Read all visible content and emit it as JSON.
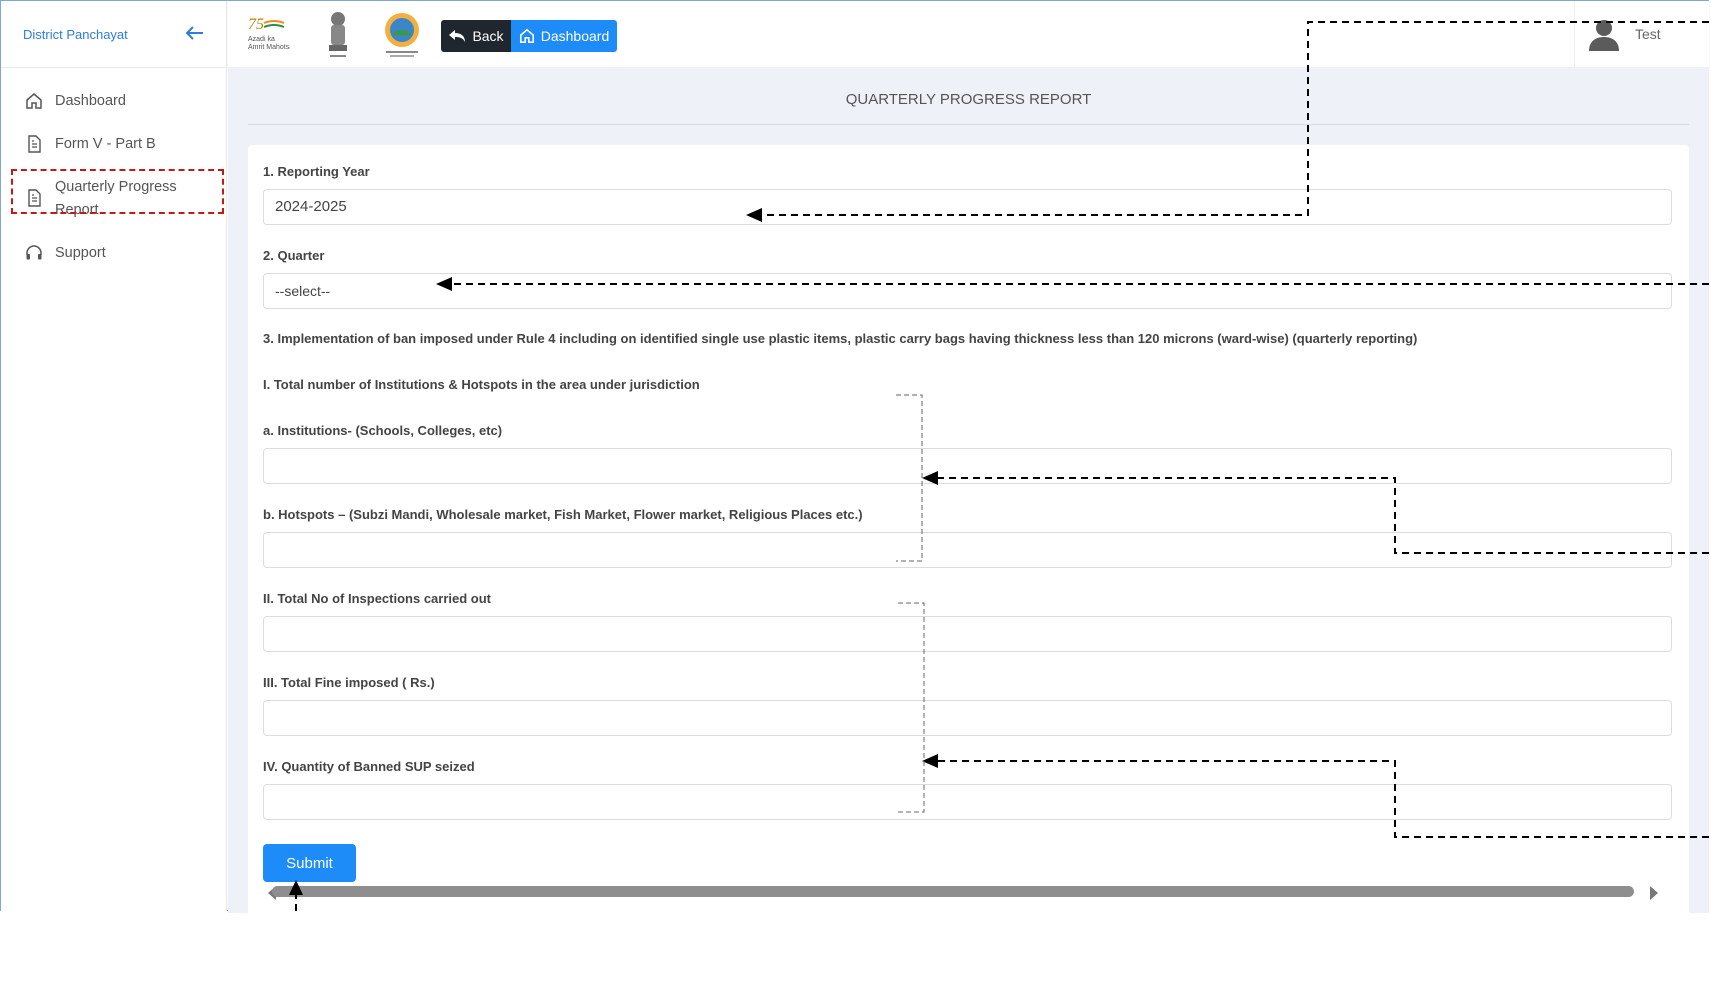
{
  "sidebar": {
    "title": "District Panchayat",
    "items": [
      {
        "label": "Dashboard"
      },
      {
        "label": "Form V - Part B"
      },
      {
        "label": "Quarterly Progress Report"
      },
      {
        "label": "Support"
      }
    ]
  },
  "topbar": {
    "back_label": "Back",
    "dashboard_label": "Dashboard",
    "user_name": "Test"
  },
  "page": {
    "title": "QUARTERLY PROGRESS REPORT",
    "q1_label": "1. Reporting Year",
    "q1_value": "2024-2025",
    "q2_label": "2. Quarter",
    "q2_value": "--select--",
    "q3_label": "3. Implementation of ban imposed under Rule 4 including on identified single use plastic items, plastic carry bags having thickness less than 120 microns (ward-wise) (quarterly reporting)",
    "i_label": "I. Total number of Institutions & Hotspots in the area under jurisdiction",
    "a_label": "a. Institutions- (Schools, Colleges, etc)",
    "b_label": "b. Hotspots – (Subzi Mandi, Wholesale market, Fish Market, Flower market, Religious Places etc.)",
    "ii_label": "II. Total No of Inspections carried out",
    "iii_label": "III. Total Fine imposed ( Rs.)",
    "iv_label": "IV. Quantity of Banned SUP seized",
    "submit_label": "Submit"
  }
}
